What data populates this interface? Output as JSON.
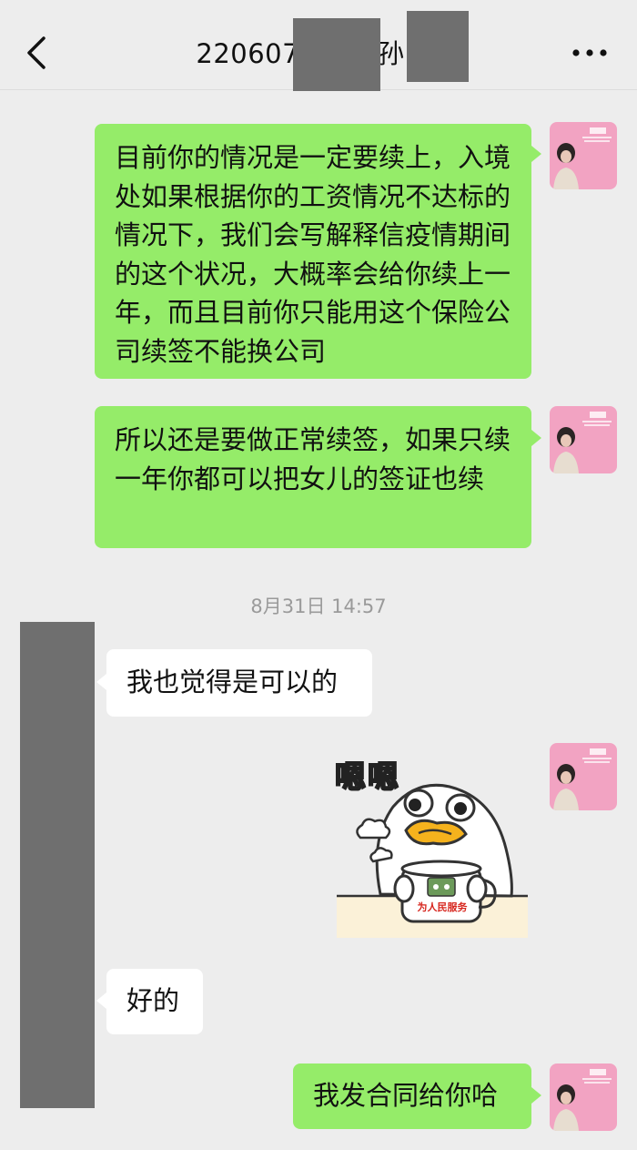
{
  "header": {
    "title": "220607",
    "title_suffix": "孙",
    "back_icon": "chevron-left-icon",
    "more_icon": "more-dots-icon"
  },
  "messages": [
    {
      "side": "me",
      "text": "目前你的情况是一定要续上，入境处如果根据你的工资情况不达标的情况下，我们会写解释信疫情期间的这个状况，大概率会给你续上一年，而且目前你只能用这个保险公司续签不能换公司"
    },
    {
      "side": "me",
      "text": "所以还是要做正常续签，如果只续一年你都可以把女儿的签证也续"
    },
    {
      "side": "them",
      "text": "我也觉得是可以的"
    },
    {
      "side": "them",
      "text": "好的"
    },
    {
      "side": "me",
      "text": "我发合同给你哈"
    }
  ],
  "timestamp": "8月31日 14:57",
  "sticker": {
    "caption": "嗯嗯",
    "cup_label": "为人民服务"
  },
  "colors": {
    "background": "#ededed",
    "my_bubble": "#95ec69",
    "their_bubble": "#ffffff",
    "avatar_pink": "#f2a3c2"
  }
}
